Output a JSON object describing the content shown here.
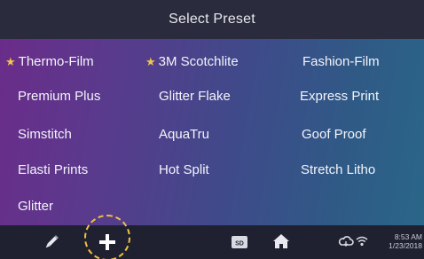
{
  "header": {
    "title": "Select Preset"
  },
  "presets": [
    {
      "label": "Thermo-Film",
      "starred": true
    },
    {
      "label": "3M Scotchlite",
      "starred": true
    },
    {
      "label": "Fashion-Film",
      "starred": false
    },
    {
      "label": "Premium Plus",
      "starred": false
    },
    {
      "label": "Glitter Flake",
      "starred": false
    },
    {
      "label": "Express Print",
      "starred": false
    },
    {
      "label": "Simstitch",
      "starred": false
    },
    {
      "label": "AquaTru",
      "starred": false
    },
    {
      "label": "Goof Proof",
      "starred": false
    },
    {
      "label": "Elasti Prints",
      "starred": false
    },
    {
      "label": "Hot Split",
      "starred": false
    },
    {
      "label": "Stretch Litho",
      "starred": false
    },
    {
      "label": "Glitter",
      "starred": false
    }
  ],
  "footer": {
    "icons": [
      "pencil-icon",
      "plus-icon",
      "sd-card-icon",
      "home-icon",
      "cloud-icon",
      "wifi-icon"
    ],
    "time": "8:53 AM",
    "date": "1/23/2018"
  },
  "colors": {
    "star": "#f3c54a",
    "highlight": "#f0c040",
    "header_bg": "#2a2b3c",
    "footer_bg": "#1f2130"
  }
}
